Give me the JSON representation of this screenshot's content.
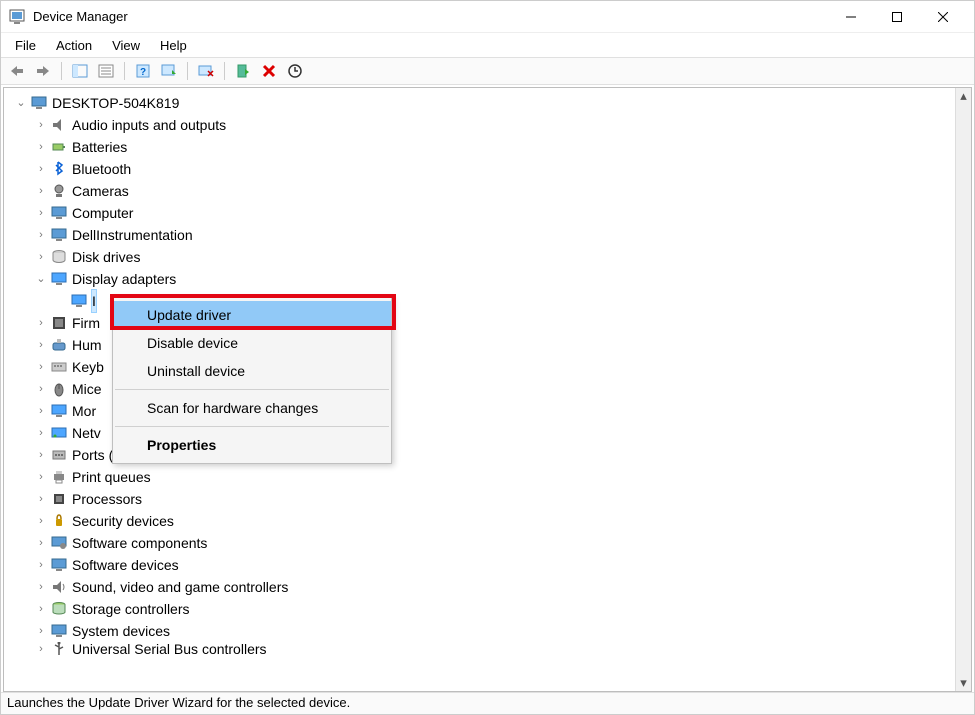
{
  "window": {
    "title": "Device Manager"
  },
  "menu": {
    "file": "File",
    "action": "Action",
    "view": "View",
    "help": "Help"
  },
  "tree": {
    "root": "DESKTOP-504K819",
    "items": [
      {
        "label": "Audio inputs and outputs",
        "icon": "audio"
      },
      {
        "label": "Batteries",
        "icon": "battery"
      },
      {
        "label": "Bluetooth",
        "icon": "bluetooth"
      },
      {
        "label": "Cameras",
        "icon": "camera"
      },
      {
        "label": "Computer",
        "icon": "computer"
      },
      {
        "label": "DellInstrumentation",
        "icon": "dell"
      },
      {
        "label": "Disk drives",
        "icon": "disk"
      },
      {
        "label": "Display adapters",
        "icon": "display",
        "expanded": true
      },
      {
        "label": "I",
        "icon": "display",
        "child": true,
        "selected": true
      },
      {
        "label": "Firm",
        "icon": "firmware",
        "truncated": true
      },
      {
        "label": "Hum",
        "icon": "hid",
        "truncated": true
      },
      {
        "label": "Keyb",
        "icon": "keyboard",
        "truncated": true
      },
      {
        "label": "Mice",
        "icon": "mouse",
        "truncated": true
      },
      {
        "label": "Mor",
        "icon": "monitor",
        "truncated": true
      },
      {
        "label": "Netv",
        "icon": "network",
        "truncated": true
      },
      {
        "label": "Ports (COM & LPT)",
        "icon": "ports"
      },
      {
        "label": "Print queues",
        "icon": "printer"
      },
      {
        "label": "Processors",
        "icon": "cpu"
      },
      {
        "label": "Security devices",
        "icon": "security"
      },
      {
        "label": "Software components",
        "icon": "swcomp"
      },
      {
        "label": "Software devices",
        "icon": "swdev"
      },
      {
        "label": "Sound, video and game controllers",
        "icon": "sound"
      },
      {
        "label": "Storage controllers",
        "icon": "storage"
      },
      {
        "label": "System devices",
        "icon": "system"
      },
      {
        "label": "Universal Serial Bus controllers",
        "icon": "usb",
        "cut": true
      }
    ]
  },
  "context_menu": {
    "update_driver": "Update driver",
    "disable_device": "Disable device",
    "uninstall_device": "Uninstall device",
    "scan": "Scan for hardware changes",
    "properties": "Properties"
  },
  "status": {
    "text": "Launches the Update Driver Wizard for the selected device."
  }
}
